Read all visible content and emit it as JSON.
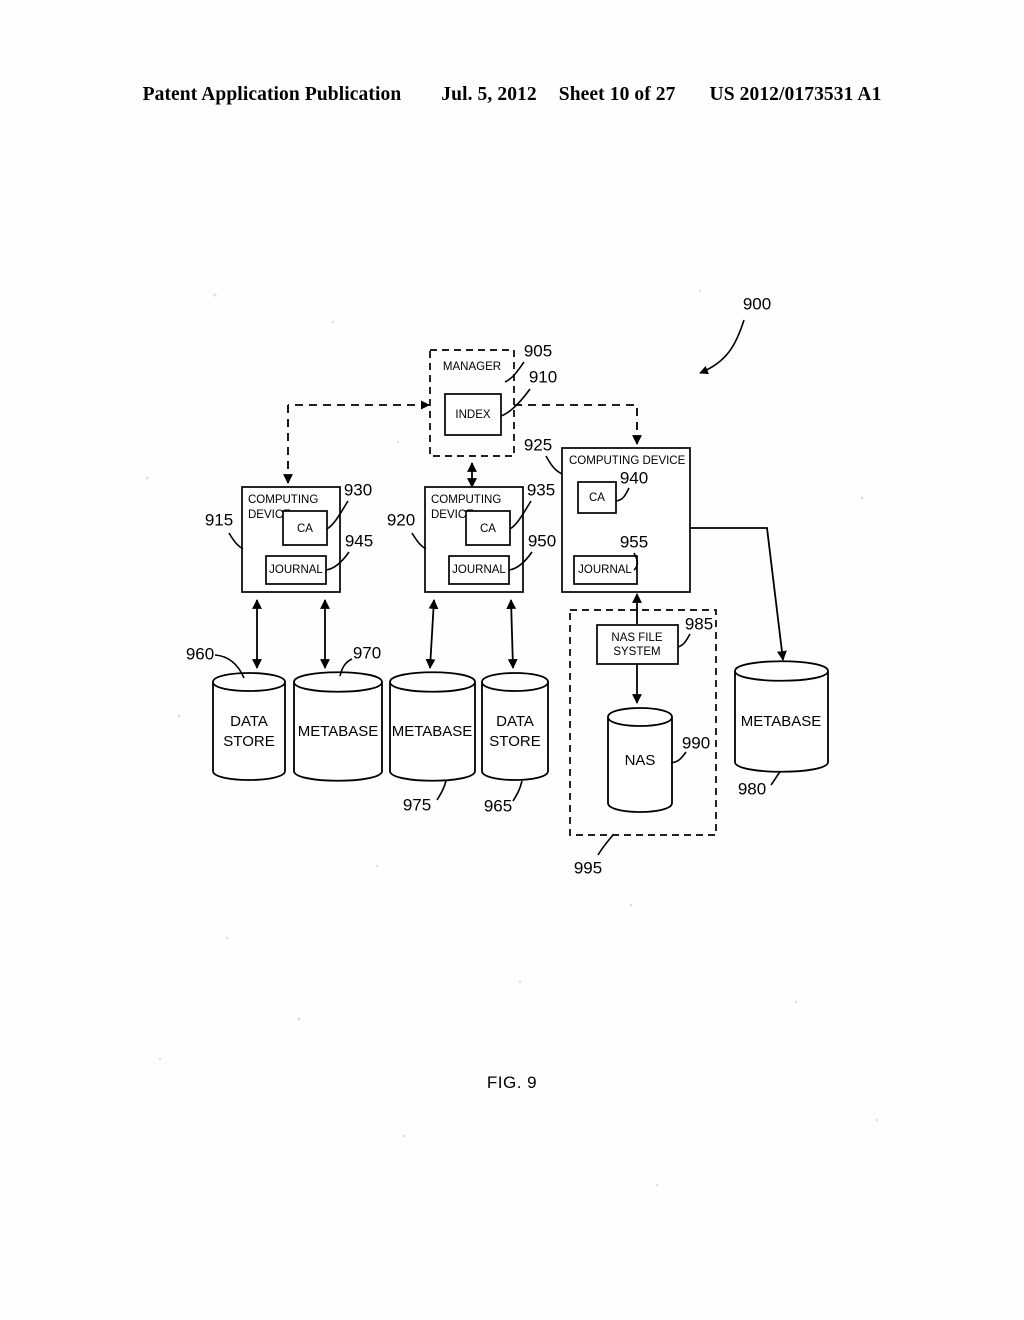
{
  "header": {
    "publication": "Patent Application Publication",
    "date": "Jul. 5, 2012",
    "sheet": "Sheet 10 of 27",
    "number": "US 2012/0173531 A1"
  },
  "figure": {
    "caption": "FIG. 9",
    "system_ref": "900"
  },
  "nodes": {
    "manager": {
      "label": "MANAGER",
      "ref": "905"
    },
    "index": {
      "label": "INDEX",
      "ref": "910"
    },
    "device_left": {
      "label_line1": "COMPUTING",
      "label_line2": "DEVICE",
      "ref": "915"
    },
    "device_mid": {
      "label_line1": "COMPUTING",
      "label_line2": "DEVICE",
      "ref": "920"
    },
    "device_right": {
      "label": "COMPUTING DEVICE",
      "ref": "925"
    },
    "ca_left": {
      "label": "CA",
      "ref": "930"
    },
    "ca_mid": {
      "label": "CA",
      "ref": "935"
    },
    "ca_right": {
      "label": "CA",
      "ref": "940"
    },
    "journal_left": {
      "label": "JOURNAL",
      "ref": "945"
    },
    "journal_mid": {
      "label": "JOURNAL",
      "ref": "950"
    },
    "journal_right": {
      "label": "JOURNAL",
      "ref": "955"
    },
    "data_store_left": {
      "line1": "DATA",
      "line2": "STORE",
      "ref": "960"
    },
    "data_store_right": {
      "line1": "DATA",
      "line2": "STORE",
      "ref": "965"
    },
    "metabase_1": {
      "label": "METABASE",
      "ref": "970"
    },
    "metabase_2": {
      "label": "METABASE",
      "ref": "975"
    },
    "metabase_3": {
      "label": "METABASE",
      "ref": "980"
    },
    "nas_file_system": {
      "line1": "NAS FILE",
      "line2": "SYSTEM",
      "ref": "985"
    },
    "nas": {
      "label": "NAS",
      "ref": "990"
    },
    "nas_group": {
      "ref": "995"
    }
  }
}
